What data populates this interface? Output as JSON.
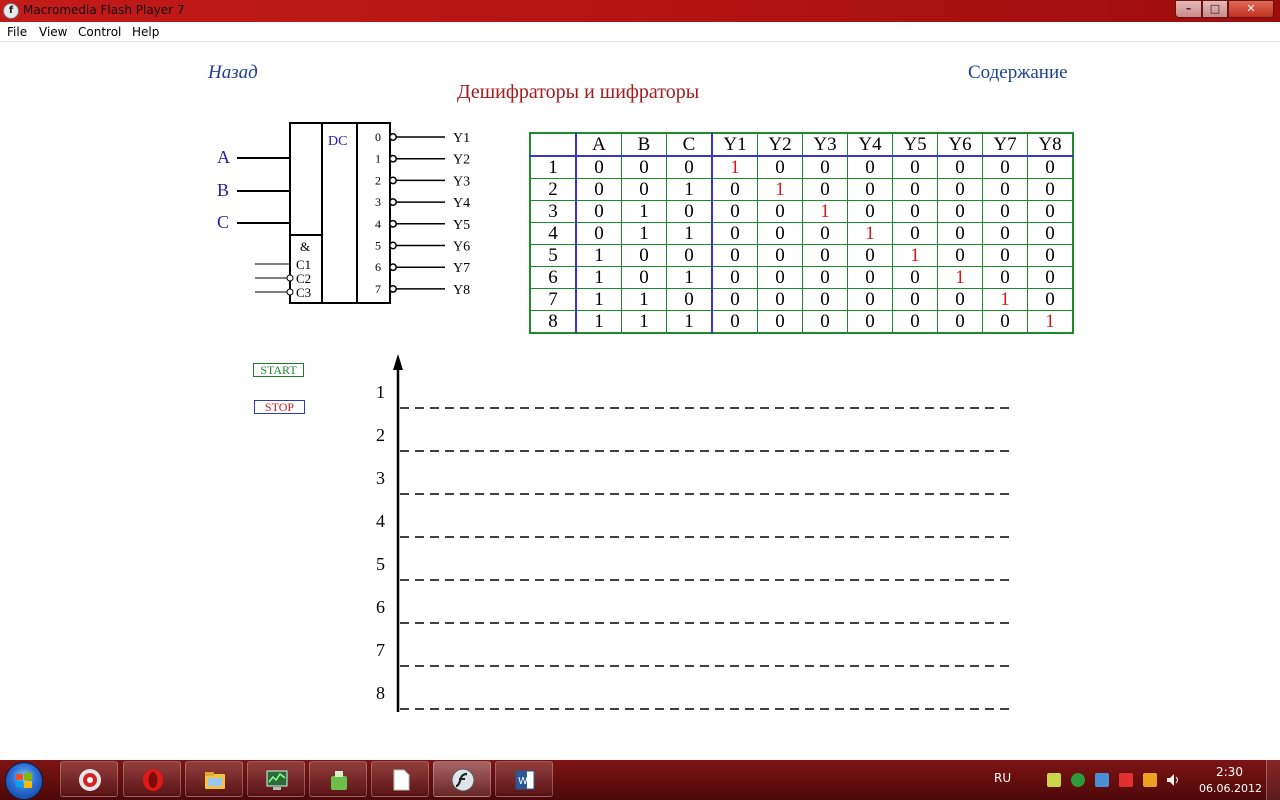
{
  "window": {
    "title": "Macromedia Flash Player 7"
  },
  "menu": [
    "File",
    "View",
    "Control",
    "Help"
  ],
  "nav": {
    "back": "Назад",
    "contents": "Содержание"
  },
  "page": {
    "title": "Дешифраторы и шифраторы"
  },
  "decoder": {
    "inputs": [
      "A",
      "B",
      "C"
    ],
    "block_label": "DC",
    "and_label": "&",
    "enables": [
      "C1",
      "C2",
      "C3"
    ],
    "output_indices": [
      "0",
      "1",
      "2",
      "3",
      "4",
      "5",
      "6",
      "7"
    ],
    "outputs": [
      "Y1",
      "Y2",
      "Y3",
      "Y4",
      "Y5",
      "Y6",
      "Y7",
      "Y8"
    ]
  },
  "truth_table": {
    "headers": [
      "",
      "A",
      "B",
      "C",
      "Y1",
      "Y2",
      "Y3",
      "Y4",
      "Y5",
      "Y6",
      "Y7",
      "Y8"
    ],
    "rows": [
      [
        "1",
        "0",
        "0",
        "0",
        "1",
        "0",
        "0",
        "0",
        "0",
        "0",
        "0",
        "0"
      ],
      [
        "2",
        "0",
        "0",
        "1",
        "0",
        "1",
        "0",
        "0",
        "0",
        "0",
        "0",
        "0"
      ],
      [
        "3",
        "0",
        "1",
        "0",
        "0",
        "0",
        "1",
        "0",
        "0",
        "0",
        "0",
        "0"
      ],
      [
        "4",
        "0",
        "1",
        "1",
        "0",
        "0",
        "0",
        "1",
        "0",
        "0",
        "0",
        "0"
      ],
      [
        "5",
        "1",
        "0",
        "0",
        "0",
        "0",
        "0",
        "0",
        "1",
        "0",
        "0",
        "0"
      ],
      [
        "6",
        "1",
        "0",
        "1",
        "0",
        "0",
        "0",
        "0",
        "0",
        "1",
        "0",
        "0"
      ],
      [
        "7",
        "1",
        "1",
        "0",
        "0",
        "0",
        "0",
        "0",
        "0",
        "0",
        "1",
        "0"
      ],
      [
        "8",
        "1",
        "1",
        "1",
        "0",
        "0",
        "0",
        "0",
        "0",
        "0",
        "0",
        "1"
      ]
    ]
  },
  "controls": {
    "start": "START",
    "stop": "STOP"
  },
  "timing": {
    "lines": [
      "1",
      "2",
      "3",
      "4",
      "5",
      "6",
      "7",
      "8"
    ]
  },
  "taskbar": {
    "items": [
      "opera-mini-icon",
      "opera-icon",
      "file-explorer-icon",
      "task-manager-icon",
      "recycle-icon",
      "blank-document-icon",
      "flash-player-icon",
      "word-icon"
    ],
    "language": "RU",
    "time": "2:30",
    "date": "06.06.2012"
  },
  "colors": {
    "titlebar": "#b01313",
    "taskbar": "#6a1010",
    "link": "#1c3f94",
    "heading": "#a51b1b",
    "table_border": "#1f8a2c",
    "table_divider": "#3a36c4",
    "active_value": "#d21a1a",
    "diagram_label": "#2b1aa6"
  }
}
